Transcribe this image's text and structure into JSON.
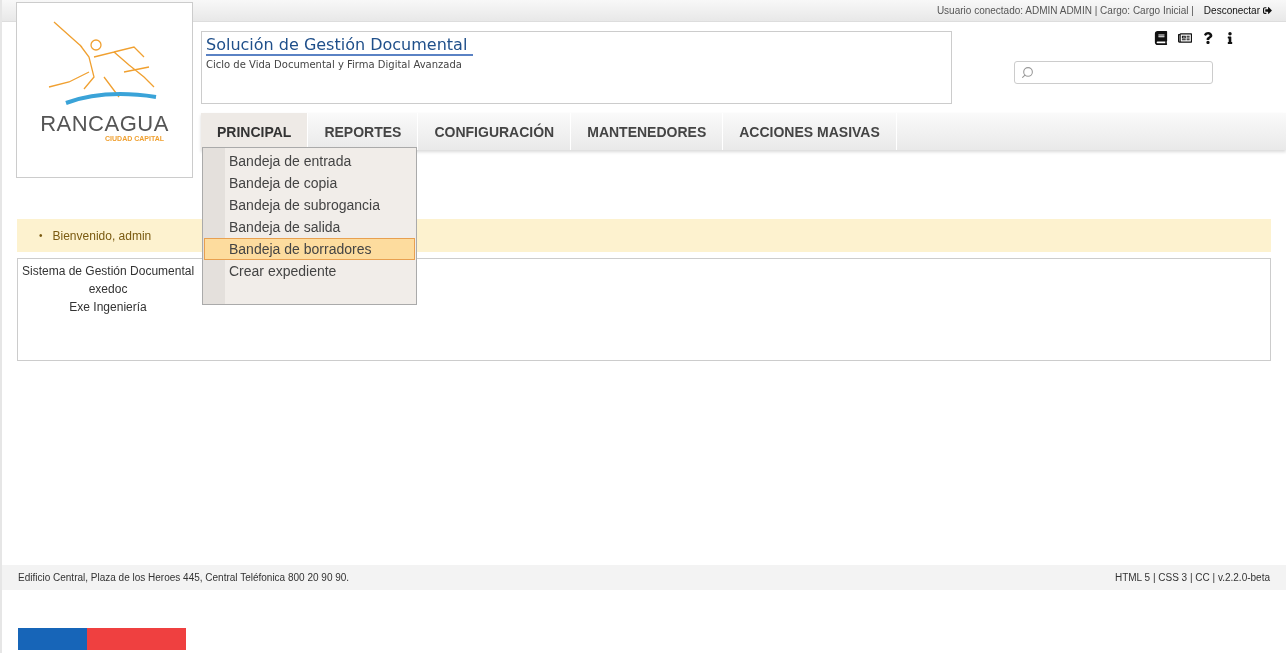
{
  "top_bar": {
    "user_info": "Usuario conectado: ADMIN ADMIN | Cargo: Cargo Inicial |",
    "logout": "Desconectar"
  },
  "logo": {
    "name": "RANCAGUA",
    "tagline": "CIUDAD CAPITAL"
  },
  "header": {
    "title": "Solución de Gestión Documental",
    "subtitle": "Ciclo de Vida Documental y Firma Digital Avanzada"
  },
  "nav": [
    {
      "label": "PRINCIPAL",
      "expanded": true,
      "items": [
        {
          "label": "Bandeja de entrada",
          "selected": false
        },
        {
          "label": "Bandeja de copia",
          "selected": false
        },
        {
          "label": "Bandeja de subrogancia",
          "selected": false
        },
        {
          "label": "Bandeja de salida",
          "selected": false
        },
        {
          "label": "Bandeja de borradores",
          "selected": true
        },
        {
          "label": "Crear expediente",
          "selected": false
        }
      ]
    },
    {
      "label": "REPORTES",
      "expanded": false
    },
    {
      "label": "CONFIGURACIÓN",
      "expanded": false
    },
    {
      "label": "MANTENEDORES",
      "expanded": false
    },
    {
      "label": "ACCIONES MASIVAS",
      "expanded": false
    }
  ],
  "message": {
    "marker": "•",
    "text": "Bienvenido, admin"
  },
  "info_lines": [
    "Sistema de Gestión Documental",
    "exedoc",
    "Exe Ingeniería"
  ],
  "footer": {
    "address": "Edificio Central, Plaza de los Heroes 445, Central Teléfonica 800 20 90 90.",
    "versions": "HTML 5 | CSS 3 | CC | v.2.2.0-beta"
  }
}
